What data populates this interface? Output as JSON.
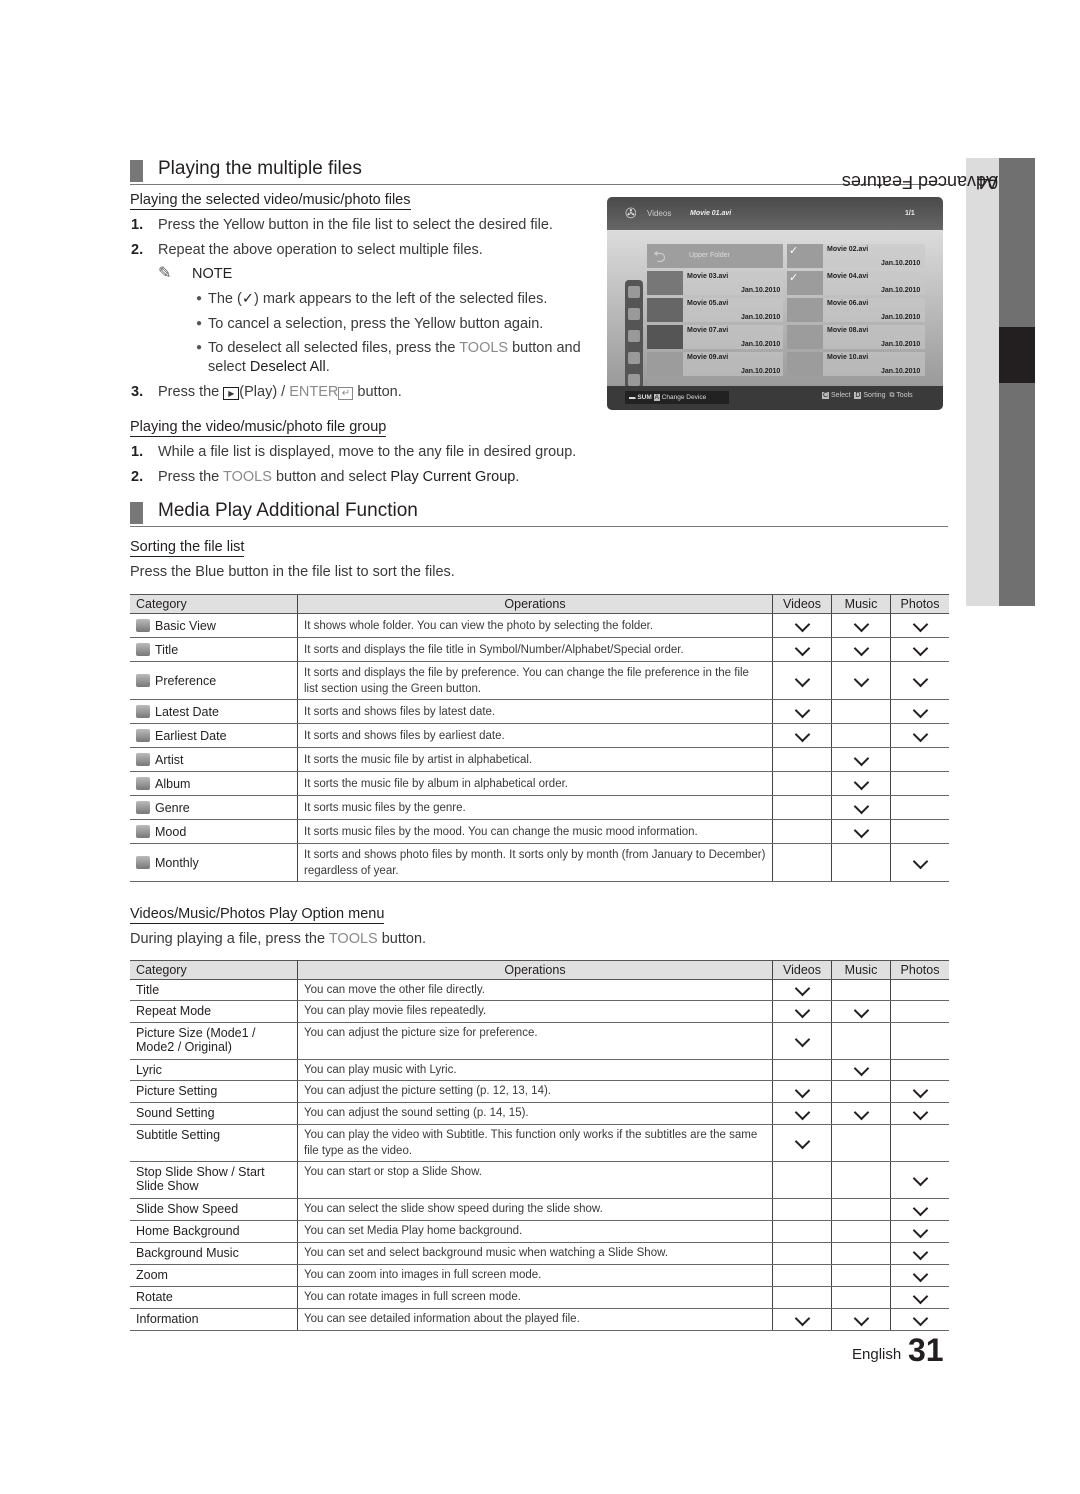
{
  "chapter": {
    "number": "04",
    "title": "Advanced Features"
  },
  "section1": {
    "title": "Playing the multiple files",
    "sub1": {
      "title": "Playing the selected video/music/photo files",
      "steps": [
        {
          "n": "1.",
          "text": "Press the Yellow button in the file list to select the desired file."
        },
        {
          "n": "2.",
          "text": "Repeat the above operation to select multiple files."
        }
      ],
      "note_label": "NOTE",
      "notes": [
        {
          "pre": "The (",
          "mid": "✓",
          "post": ") mark appears to the left of the selected files."
        },
        {
          "text": "To cancel a selection, press the Yellow button again."
        },
        {
          "pre": "To deselect all selected files, press the ",
          "tools": "TOOLS",
          "post": " button and",
          "line2_pre": "select ",
          "line2_bold": "Deselect All",
          "line2_post": "."
        }
      ],
      "step3": {
        "n": "3.",
        "pre": "Press the ",
        "play": "(Play) / ",
        "enter": "ENTER",
        "post": " button."
      }
    },
    "sub2": {
      "title": "Playing the video/music/photo file group",
      "steps": [
        {
          "n": "1.",
          "text": "While a file list is displayed, move to the any file in desired group."
        },
        {
          "n": "2.",
          "pre": "Press the ",
          "tools": "TOOLS",
          "mid": " button and select ",
          "bold": "Play Current Group",
          "post": "."
        }
      ]
    }
  },
  "tv": {
    "section": "Videos",
    "current_file": "Movie 01.avi",
    "page": "1/1",
    "upper_folder": "Upper  Folder",
    "files": [
      {
        "name": "Movie 02.avi",
        "date": "Jan.10.2010",
        "checked": true
      },
      {
        "name": "Movie 03.avi",
        "date": "Jan.10.2010",
        "checked": false
      },
      {
        "name": "Movie 04.avi",
        "date": "Jan.10.2010",
        "checked": true
      },
      {
        "name": "Movie 05.avi",
        "date": "Jan.10.2010",
        "checked": false
      },
      {
        "name": "Movie 06.avi",
        "date": "Jan.10.2010",
        "checked": false
      },
      {
        "name": "Movie 07.avi",
        "date": "Jan.10.2010",
        "checked": false
      },
      {
        "name": "Movie 08.avi",
        "date": "Jan.10.2010",
        "checked": false
      },
      {
        "name": "Movie 09.avi",
        "date": "Jan.10.2010",
        "checked": false
      },
      {
        "name": "Movie 10.avi",
        "date": "Jan.10.2010",
        "checked": false
      }
    ],
    "footer": {
      "device": "SUM",
      "a_key": "A",
      "change_device": "Change Device",
      "c_key": "C",
      "select": "Select",
      "d_key": "D",
      "sorting": "Sorting",
      "tools": "Tools"
    }
  },
  "section2": {
    "title": "Media Play Additional Function",
    "sort": {
      "title": "Sorting the file list",
      "intro": "Press the Blue button in the file list to sort the files.",
      "headers": [
        "Category",
        "Operations",
        "Videos",
        "Music",
        "Photos"
      ],
      "rows": [
        {
          "icon": "folder-icon",
          "cat": "Basic View",
          "op": "It shows whole folder. You can view the photo by selecting the folder.",
          "v": true,
          "m": true,
          "p": true
        },
        {
          "icon": "title-sort-icon",
          "cat": "Title",
          "op": "It sorts and displays the file title in Symbol/Number/Alphabet/Special order.",
          "v": true,
          "m": true,
          "p": true
        },
        {
          "icon": "star-icon",
          "cat": "Preference",
          "op": "It sorts and displays the file by preference. You can change the file preference in the file list section using the Green button.",
          "v": true,
          "m": true,
          "p": true
        },
        {
          "icon": "calendar-latest-icon",
          "cat": "Latest Date",
          "op": "It sorts and shows files by latest date.",
          "v": true,
          "m": false,
          "p": true
        },
        {
          "icon": "calendar-earliest-icon",
          "cat": "Earliest Date",
          "op": "It sorts and shows files by earliest date.",
          "v": true,
          "m": false,
          "p": true
        },
        {
          "icon": "artist-icon",
          "cat": "Artist",
          "op": "It sorts the music file by artist in alphabetical.",
          "v": false,
          "m": true,
          "p": false
        },
        {
          "icon": "album-icon",
          "cat": "Album",
          "op": "It sorts the music file by album in alphabetical order.",
          "v": false,
          "m": true,
          "p": false
        },
        {
          "icon": "genre-icon",
          "cat": "Genre",
          "op": "It sorts music files by the genre.",
          "v": false,
          "m": true,
          "p": false
        },
        {
          "icon": "mood-icon",
          "cat": "Mood",
          "op": "It sorts music files by the mood. You can change the music mood information.",
          "v": false,
          "m": true,
          "p": false
        },
        {
          "icon": "monthly-icon",
          "cat": "Monthly",
          "op": "It sorts and shows photo files by month. It sorts only by month (from January to December) regardless of year.",
          "v": false,
          "m": false,
          "p": true
        }
      ]
    },
    "play": {
      "title": "Videos/Music/Photos Play Option menu",
      "intro_pre": "During playing a file, press the ",
      "intro_tools": "TOOLS",
      "intro_post": " button.",
      "headers": [
        "Category",
        "Operations",
        "Videos",
        "Music",
        "Photos"
      ],
      "rows": [
        {
          "cat": "Title",
          "op": "You can move the other file directly.",
          "v": true,
          "m": false,
          "p": false
        },
        {
          "cat": "Repeat Mode",
          "op": "You can play movie files repeatedly.",
          "v": true,
          "m": true,
          "p": false
        },
        {
          "cat": "Picture Size (Mode1 / Mode2 / Original)",
          "op": "You can adjust the picture size for preference.",
          "v": true,
          "m": false,
          "p": false
        },
        {
          "cat": "Lyric",
          "op": "You can play music with Lyric.",
          "v": false,
          "m": true,
          "p": false
        },
        {
          "cat": "Picture Setting",
          "op": "You can adjust the picture setting (p. 12, 13, 14).",
          "v": true,
          "m": false,
          "p": true
        },
        {
          "cat": "Sound Setting",
          "op": "You can adjust the sound setting (p. 14, 15).",
          "v": true,
          "m": true,
          "p": true
        },
        {
          "cat": "Subtitle Setting",
          "op": "You can play the video with Subtitle. This function only works if the subtitles are the same file type as the video.",
          "v": true,
          "m": false,
          "p": false
        },
        {
          "cat": "Stop Slide Show / Start Slide Show",
          "op": "You can start or stop a Slide Show.",
          "v": false,
          "m": false,
          "p": true
        },
        {
          "cat": "Slide Show Speed",
          "op": "You can select the slide show speed during the slide show.",
          "v": false,
          "m": false,
          "p": true
        },
        {
          "cat": "Home Background",
          "op": "You can set Media Play home background.",
          "v": false,
          "m": false,
          "p": true
        },
        {
          "cat": "Background Music",
          "op": "You can set and select background music when watching a Slide Show.",
          "v": false,
          "m": false,
          "p": true
        },
        {
          "cat": "Zoom",
          "op": "You can zoom into images in full screen mode.",
          "v": false,
          "m": false,
          "p": true
        },
        {
          "cat": "Rotate",
          "op": "You can rotate images in full screen mode.",
          "v": false,
          "m": false,
          "p": true
        },
        {
          "cat": "Information",
          "op": "You can see detailed information about the played file.",
          "v": true,
          "m": true,
          "p": true
        }
      ]
    }
  },
  "footer": {
    "language": "English",
    "page": "31"
  }
}
